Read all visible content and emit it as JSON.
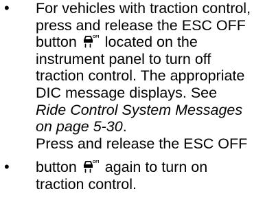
{
  "bullets": [
    {
      "lines": [
        "For vehicles with traction control,",
        "press and release the ESC OFF",
        "button",
        "located on the",
        "instrument panel to turn off",
        "traction control. The appropriate",
        "DIC message displays. See",
        "Ride Control System Messages",
        "on page 5-30",
        "."
      ],
      "icon": "esc-off-icon"
    },
    {
      "lines": [
        "Press and release the ESC OFF",
        "button",
        "again to turn on",
        "traction control."
      ],
      "icon": "esc-off-icon"
    }
  ]
}
